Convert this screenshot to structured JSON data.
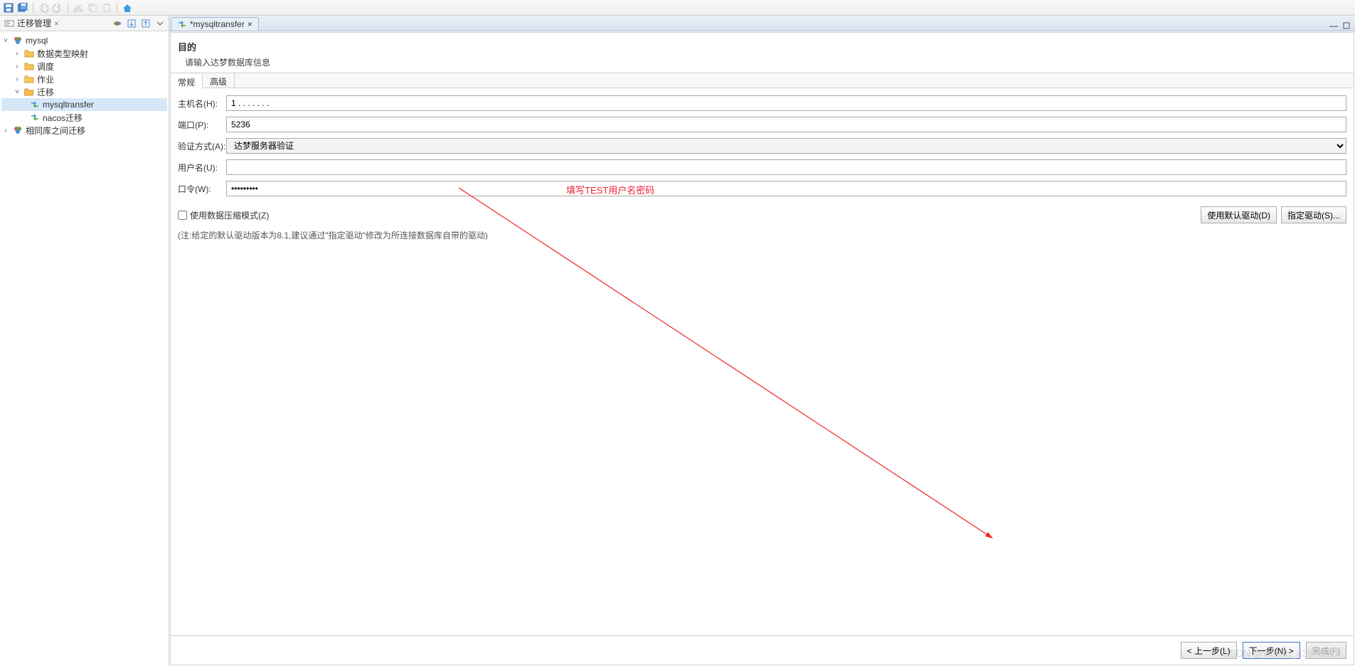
{
  "toolbar": {
    "save_icon": "save-icon",
    "saveall_icon": "saveall-icon",
    "undo_icon": "undo-icon",
    "redo_icon": "redo-icon",
    "cut_icon": "cut-icon",
    "copy_icon": "copy-icon",
    "paste_icon": "paste-icon",
    "home_icon": "home-icon"
  },
  "sidebar": {
    "tab_label": "迁移管理",
    "tree": {
      "root": "mysql",
      "items": [
        {
          "label": "数据类型映射"
        },
        {
          "label": "调度"
        },
        {
          "label": "作业"
        },
        {
          "label": "迁移",
          "expanded": true,
          "children": [
            {
              "label": "mysqltransfer",
              "selected": true
            },
            {
              "label": "nacos迁移"
            }
          ]
        }
      ],
      "sibling": "相同库之间迁移"
    }
  },
  "editor": {
    "tab_label": "*mysqltransfer"
  },
  "page": {
    "title": "目的",
    "subtitle": "请输入达梦数据库信息",
    "tabs": {
      "general": "常规",
      "advanced": "高级"
    },
    "form": {
      "host_label": "主机名(H):",
      "host_value": "1 . . . . . . .",
      "port_label": "端口(P):",
      "port_value": "5236",
      "auth_label": "验证方式(A):",
      "auth_value": "达梦服务器验证",
      "user_label": "用户名(U):",
      "user_value": "",
      "pwd_label": "口令(W):",
      "pwd_value": "•••••••••",
      "compress_label": "使用数据压缩模式(Z)",
      "default_driver_btn": "使用默认驱动(D)",
      "specify_driver_btn": "指定驱动(S)...",
      "note": "(注:给定的默认驱动版本为8.1,建议通过\"指定驱动\"修改为所连接数据库自带的驱动)"
    },
    "annotation": "填写TEST用户名密码",
    "footer": {
      "back": "< 上一步(L)",
      "next": "下一步(N) >",
      "finish": "完成(F)"
    }
  },
  "watermark": "CSDN @weixin_43975316"
}
